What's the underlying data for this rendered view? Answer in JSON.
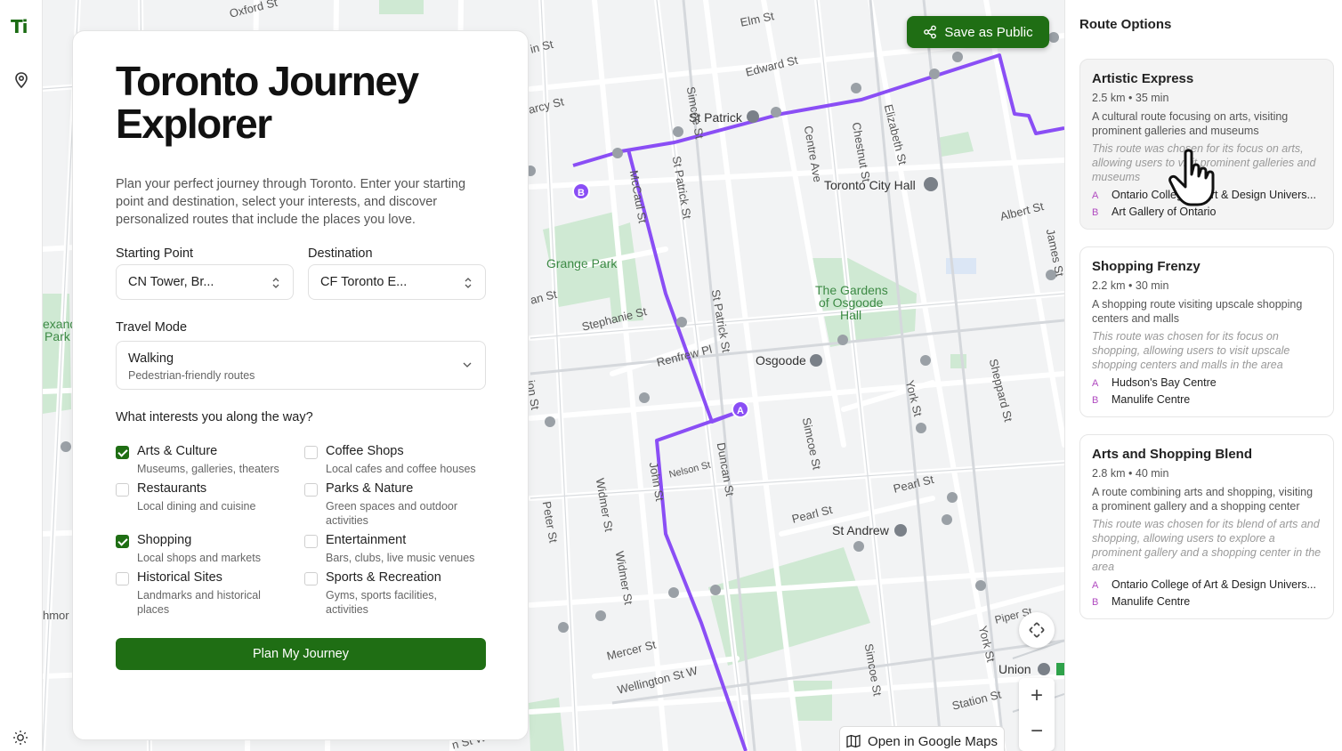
{
  "app": {
    "logo": "Ti"
  },
  "map": {
    "save_label": "Save as Public",
    "open_gmaps_label": "Open in Google Maps",
    "labels": {
      "oxford": "Oxford St",
      "elm": "Elm St",
      "edward": "Edward St",
      "st_patrick": "St Patrick",
      "simcoe_top": "Simcoe St",
      "centre_ave": "Centre Ave",
      "chestnut": "Chestnut St",
      "elizabeth": "Elizabeth St",
      "city_hall": "Toronto City Hall",
      "albert": "Albert St",
      "grange": "Grange Park",
      "mccaul": "McCaul St",
      "st_patrick_st": "St Patrick St",
      "st_patrick_st2": "St Patrick St",
      "stephanie": "Stephanie St",
      "renfrew": "Renfrew Pl",
      "osgoode": "Osgoode",
      "gardens1": "The Gardens",
      "gardens2": "of Osgoode",
      "gardens3": "Hall",
      "york": "York St",
      "sheppard": "Sheppard St",
      "duncan": "Duncan St",
      "simcoe_mid": "Simcoe St",
      "john": "John St",
      "nelson": "Nelson St",
      "pearl1": "Pearl St",
      "pearl2": "Pearl St",
      "st_andrew": "St Andrew",
      "widmer1": "Widmer St",
      "widmer2": "Widmer St",
      "peter": "Peter St",
      "mercer": "Mercer St",
      "wellington": "Wellington St W",
      "simcoe_bot": "Simcoe St",
      "york_bot": "York St",
      "union": "Union",
      "station": "Station St",
      "piper": "Piper St",
      "james": "James St",
      "darcy": "arcy St",
      "in_st": "in St",
      "an_st": "an St",
      "ion_st": "ion St",
      "king_w": "n St W",
      "exand": "exand",
      "park": "Park",
      "hmor": "hmor"
    }
  },
  "form": {
    "title": "Toronto Journey Explorer",
    "description": "Plan your perfect journey through Toronto. Enter your starting point and destination, select your interests, and discover personalized routes that include the places you love.",
    "start_label": "Starting Point",
    "start_value": "CN Tower, Br...",
    "dest_label": "Destination",
    "dest_value": "CF Toronto E...",
    "mode_label": "Travel Mode",
    "mode_value": "Walking",
    "mode_sub": "Pedestrian-friendly routes",
    "interests_label": "What interests you along the way?",
    "interests": [
      {
        "title": "Arts & Culture",
        "sub": "Museums, galleries, theaters",
        "checked": true
      },
      {
        "title": "Coffee Shops",
        "sub": "Local cafes and coffee houses",
        "checked": false
      },
      {
        "title": "Restaurants",
        "sub": "Local dining and cuisine",
        "checked": false
      },
      {
        "title": "Parks & Nature",
        "sub": "Green spaces and outdoor activities",
        "checked": false
      },
      {
        "title": "Shopping",
        "sub": "Local shops and markets",
        "checked": true
      },
      {
        "title": "Entertainment",
        "sub": "Bars, clubs, live music venues",
        "checked": false
      },
      {
        "title": "Historical Sites",
        "sub": "Landmarks and historical places",
        "checked": false
      },
      {
        "title": "Sports & Recreation",
        "sub": "Gyms, sports facilities, activities",
        "checked": false
      }
    ],
    "submit_label": "Plan My Journey"
  },
  "sidebar": {
    "title": "Route Options",
    "routes": [
      {
        "name": "Artistic Express",
        "distance": "2.5 km",
        "duration": "35 min",
        "description": "A cultural route focusing on arts, visiting prominent galleries and museums",
        "reason": "This route was chosen for its focus on arts, allowing users to visit prominent galleries and museums",
        "stop_a": "Ontario College of Art & Design Univers...",
        "stop_b": "Art Gallery of Ontario"
      },
      {
        "name": "Shopping Frenzy",
        "distance": "2.2 km",
        "duration": "30 min",
        "description": "A shopping route visiting upscale shopping centers and malls",
        "reason": "This route was chosen for its focus on shopping, allowing users to visit upscale shopping centers and malls in the area",
        "stop_a": "Hudson's Bay Centre",
        "stop_b": "Manulife Centre"
      },
      {
        "name": "Arts and Shopping Blend",
        "distance": "2.8 km",
        "duration": "40 min",
        "description": "A route combining arts and shopping, visiting a prominent gallery and a shopping center",
        "reason": "This route was chosen for its blend of arts and shopping, allowing users to explore a prominent gallery and a shopping center in the area",
        "stop_a": "Ontario College of Art & Design Univers...",
        "stop_b": "Manulife Centre"
      }
    ],
    "stop_letters": [
      "A",
      "B"
    ],
    "dot": "•"
  },
  "colors": {
    "accent": "#1f6e14",
    "route": "#8a4ef5",
    "park": "#c8e6c9"
  }
}
